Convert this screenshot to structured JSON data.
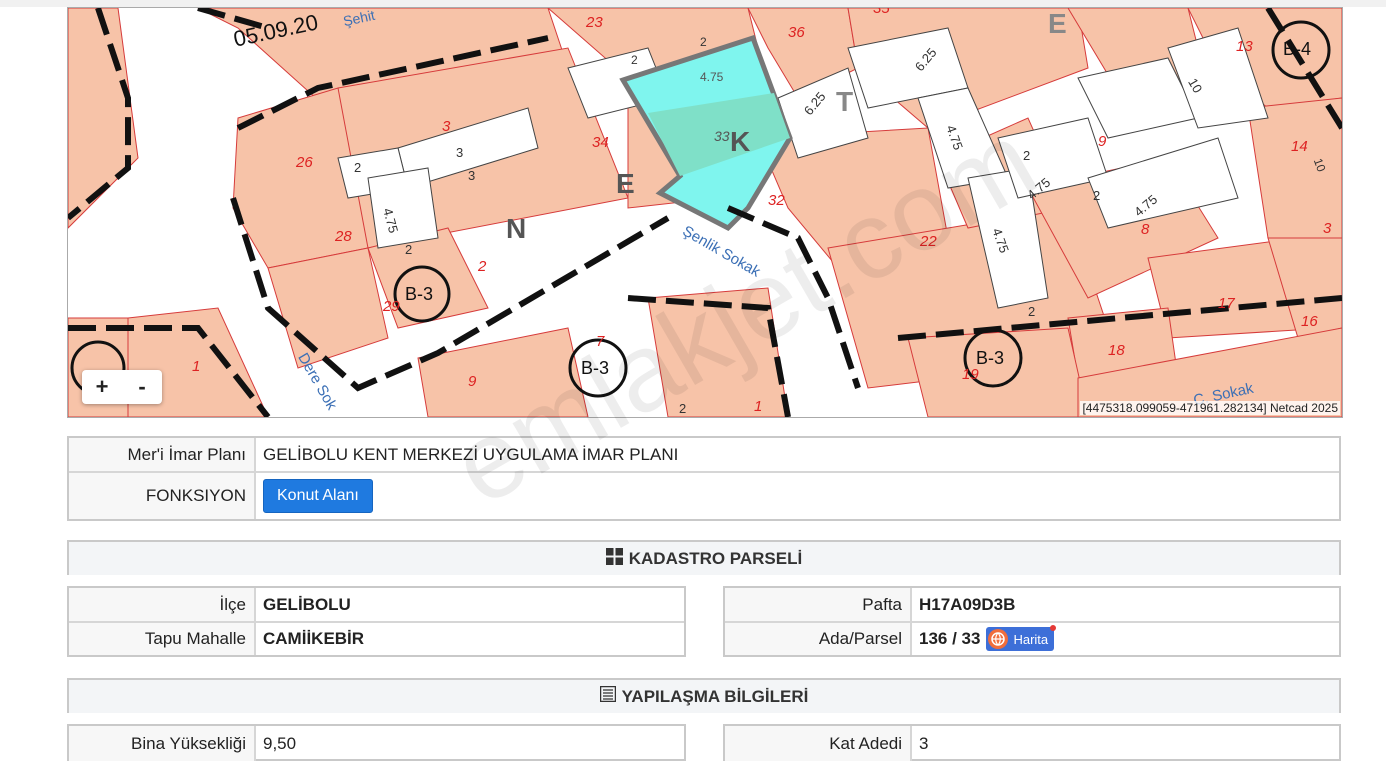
{
  "map": {
    "attribution": "[4475318.099059-471961.282134] Netcad 2025",
    "zoom_in": "+",
    "zoom_out": "-",
    "labels": {
      "date": "05.09.20",
      "street_sehit": "Şehit",
      "street_senlik": "Şenlik Sokak",
      "street_dere": "Dere Sok",
      "street_c": "C. Sokak",
      "block_b4": "B-4",
      "block_b3a": "B-3",
      "block_b3b": "B-3",
      "block_b3c": "B-3",
      "letters": [
        "N",
        "E",
        "K",
        "T",
        "E"
      ],
      "parcels": [
        "23",
        "36",
        "35",
        "13",
        "3",
        "34",
        "33",
        "26",
        "28",
        "29",
        "2",
        "32",
        "22",
        "9",
        "14",
        "8",
        "17",
        "18",
        "16",
        "19",
        "1",
        "7",
        "9",
        "1",
        "3",
        "10"
      ],
      "dims": [
        "2",
        "2",
        "4.75",
        "6.25",
        "6.25",
        "4.75",
        "2",
        "3",
        "3",
        "2",
        "4.75",
        "2",
        "4.75",
        "4.75",
        "2",
        "4.75",
        "2",
        "2",
        "10"
      ]
    }
  },
  "imar": {
    "plan_label": "Mer'i İmar Planı",
    "plan_value": "GELİBOLU KENT MERKEZİ UYGULAMA İMAR PLANI",
    "func_label": "FONKSIYON",
    "func_button": "Konut Alanı"
  },
  "kadastro": {
    "title": "KADASTRO PARSELİ",
    "ilce_label": "İlçe",
    "ilce_value": "GELİBOLU",
    "mahalle_label": "Tapu Mahalle",
    "mahalle_value": "CAMİİKEBİR",
    "pafta_label": "Pafta",
    "pafta_value": "H17A09D3B",
    "ada_label": "Ada/Parsel",
    "ada_value": "136 / 33",
    "harita_label": "Harita"
  },
  "yapilasma": {
    "title": "YAPILAŞMA BİLGİLERİ",
    "yukseklik_label": "Bina Yüksekliği",
    "yukseklik_value": "9,50",
    "kat_label": "Kat Adedi",
    "kat_value": "3"
  },
  "watermark": "emlakjet.com",
  "colors": {
    "parcel": "#f7c3a8",
    "highlight": "#7ff5ee",
    "button": "#1f7ae0"
  }
}
